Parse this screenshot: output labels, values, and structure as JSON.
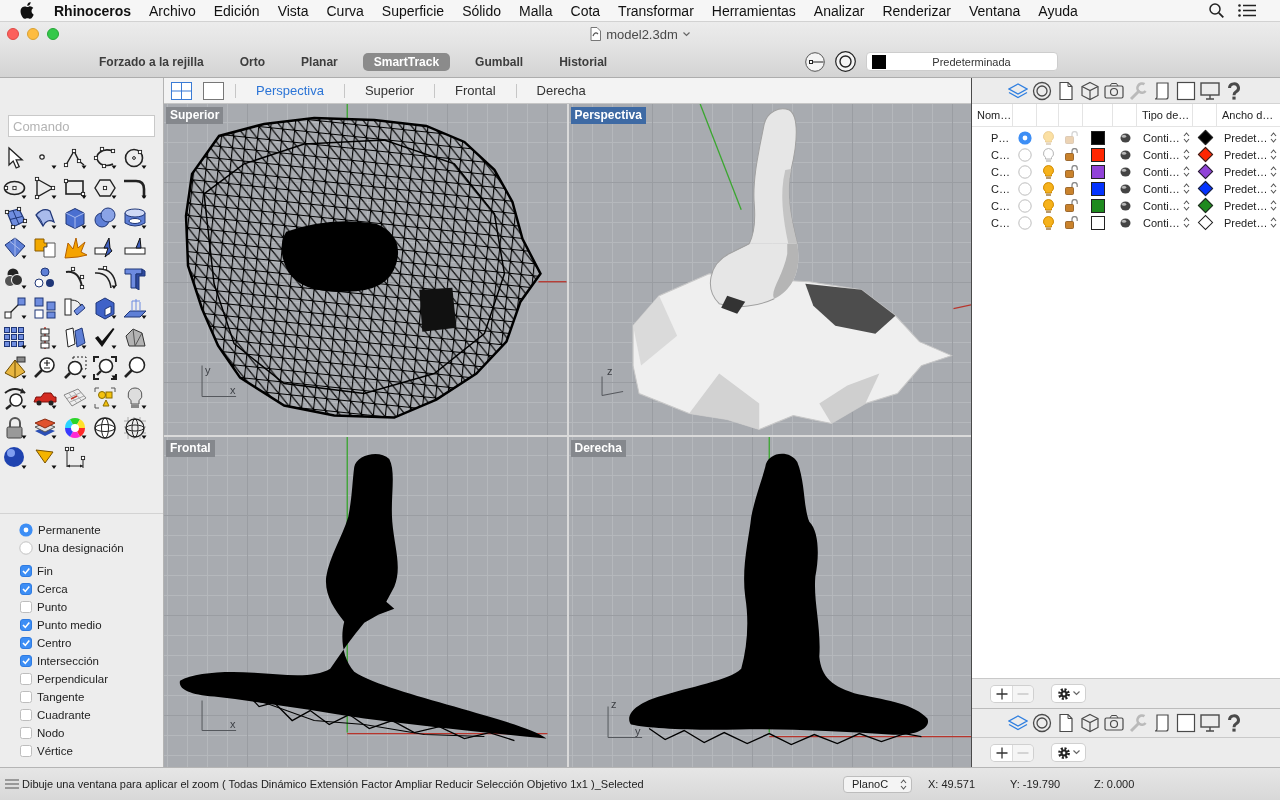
{
  "menu_bar": {
    "app": "Rhinoceros",
    "menus": [
      "Archivo",
      "Edición",
      "Vista",
      "Curva",
      "Superficie",
      "Sólido",
      "Malla",
      "Cota",
      "Transformar",
      "Herramientas",
      "Analizar",
      "Renderizar",
      "Ventana",
      "Ayuda"
    ]
  },
  "window": {
    "title": "model2.3dm"
  },
  "toolbar": {
    "toggles": [
      {
        "label": "Forzado a la rejilla",
        "selected": false
      },
      {
        "label": "Orto",
        "selected": false
      },
      {
        "label": "Planar",
        "selected": false
      },
      {
        "label": "SmartTrack",
        "selected": true
      },
      {
        "label": "Gumball",
        "selected": false
      },
      {
        "label": "Historial",
        "selected": false
      }
    ],
    "current_layer": {
      "name": "Predeterminada",
      "color": "#000000"
    }
  },
  "command_field": {
    "placeholder": "Comando"
  },
  "osnap": {
    "modes": [
      {
        "label": "Permanente",
        "selected": true
      },
      {
        "label": "Una designación",
        "selected": false
      }
    ],
    "snaps": [
      {
        "label": "Fin",
        "checked": true
      },
      {
        "label": "Cerca",
        "checked": true
      },
      {
        "label": "Punto",
        "checked": false
      },
      {
        "label": "Punto medio",
        "checked": true
      },
      {
        "label": "Centro",
        "checked": true
      },
      {
        "label": "Intersección",
        "checked": true
      },
      {
        "label": "Perpendicular",
        "checked": false
      },
      {
        "label": "Tangente",
        "checked": false
      },
      {
        "label": "Cuadrante",
        "checked": false
      },
      {
        "label": "Nodo",
        "checked": false
      },
      {
        "label": "Vértice",
        "checked": false
      }
    ]
  },
  "viewport_bar": {
    "layouts": [
      {
        "kind": "quad",
        "selected": true
      },
      {
        "kind": "single",
        "selected": false
      }
    ],
    "tabs": [
      {
        "label": "Perspectiva",
        "selected": true
      },
      {
        "label": "Superior",
        "selected": false
      },
      {
        "label": "Frontal",
        "selected": false
      },
      {
        "label": "Derecha",
        "selected": false
      }
    ]
  },
  "viewports": [
    {
      "title": "Superior",
      "kind": "top",
      "active": false,
      "axes": [
        "y",
        "x"
      ]
    },
    {
      "title": "Perspectiva",
      "kind": "perspective",
      "active": true,
      "axes": [
        "z"
      ]
    },
    {
      "title": "Frontal",
      "kind": "front",
      "active": false,
      "axes": [
        "x"
      ]
    },
    {
      "title": "Derecha",
      "kind": "right",
      "active": false,
      "axes": [
        "z",
        "y"
      ]
    }
  ],
  "layers_panel": {
    "tabs": [
      {
        "selected": true,
        "disabled": false
      },
      {
        "selected": false,
        "disabled": false
      },
      {
        "selected": false,
        "disabled": false
      },
      {
        "selected": false,
        "disabled": false
      },
      {
        "selected": false,
        "disabled": false
      },
      {
        "selected": false,
        "disabled": true
      },
      {
        "selected": false,
        "disabled": false
      },
      {
        "selected": false,
        "disabled": false
      },
      {
        "selected": false,
        "disabled": false
      },
      {
        "selected": false,
        "disabled": false
      }
    ],
    "columns": [
      "Nom…",
      "Tipo de…",
      "Ancho d…"
    ],
    "rows": [
      {
        "name": "P…",
        "current": true,
        "visible": true,
        "color": "#000000",
        "linetype": "Conti…",
        "print": {
          "color": "#000000",
          "width": "Predet…"
        }
      },
      {
        "name": "C…",
        "current": false,
        "visible": false,
        "color": "#ff2600",
        "linetype": "Conti…",
        "print": {
          "color": "#ff2600",
          "width": "Predet…"
        }
      },
      {
        "name": "C…",
        "current": false,
        "visible": true,
        "color": "#9143d8",
        "linetype": "Conti…",
        "print": {
          "color": "#9143d8",
          "width": "Predet…"
        }
      },
      {
        "name": "C…",
        "current": false,
        "visible": true,
        "color": "#0433ff",
        "linetype": "Conti…",
        "print": {
          "color": "#0433ff",
          "width": "Predet…"
        }
      },
      {
        "name": "C…",
        "current": false,
        "visible": true,
        "color": "#1e8a1e",
        "linetype": "Conti…",
        "print": {
          "color": "#1e8a1e",
          "width": "Predet…"
        }
      },
      {
        "name": "C…",
        "current": false,
        "visible": true,
        "color": "#ffffff",
        "linetype": "Conti…",
        "print": {
          "color": "#ffffff",
          "width": "Predet…"
        }
      }
    ],
    "actions": [
      {
        "kind": "add",
        "disabled": false
      },
      {
        "kind": "remove",
        "disabled": true
      }
    ]
  },
  "lower_panel": {
    "tabs": [
      {
        "selected": true,
        "disabled": false
      },
      {
        "selected": false,
        "disabled": false
      },
      {
        "selected": false,
        "disabled": false
      },
      {
        "selected": false,
        "disabled": false
      },
      {
        "selected": false,
        "disabled": false
      },
      {
        "selected": false,
        "disabled": true
      },
      {
        "selected": false,
        "disabled": false
      },
      {
        "selected": false,
        "disabled": false
      },
      {
        "selected": false,
        "disabled": false
      },
      {
        "selected": false,
        "disabled": false
      }
    ],
    "actions": [
      {
        "kind": "add",
        "disabled": false
      },
      {
        "kind": "remove",
        "disabled": true
      }
    ]
  },
  "status_bar": {
    "prompt": "Dibuje una ventana para aplicar el zoom ( Todas Dinámico Extensión Factor Ampliar Reducir Selección Objetivo 1x1 )_Selected",
    "cplane": "PlanoC",
    "x": "X: 49.571",
    "y": "Y: -19.790",
    "z": "Z: 0.000"
  }
}
